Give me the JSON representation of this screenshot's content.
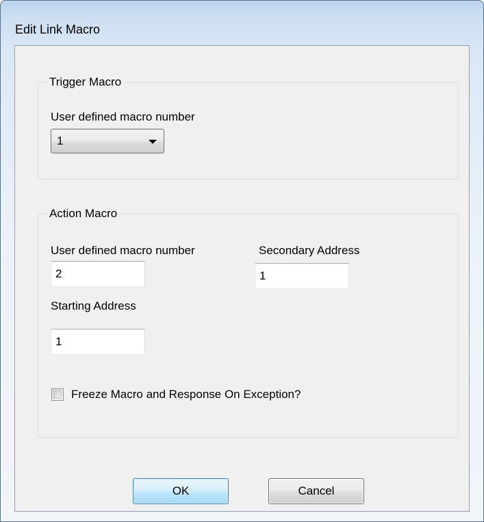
{
  "window": {
    "title": "Edit Link Macro"
  },
  "trigger_group": {
    "legend": "Trigger Macro",
    "macro_number_label": "User defined macro number",
    "macro_number_selected": "1"
  },
  "action_group": {
    "legend": "Action Macro",
    "macro_number_label": "User defined macro number",
    "macro_number_value": "2",
    "secondary_address_label": "Secondary Address",
    "secondary_address_value": "1",
    "starting_address_label": "Starting Address",
    "starting_address_value": "1",
    "freeze_label": "Freeze Macro and Response On Exception?",
    "freeze_checked": false
  },
  "buttons": {
    "ok_label": "OK",
    "cancel_label": "Cancel"
  },
  "icons": {
    "dropdown": "chevron-down-icon"
  },
  "colors": {
    "ok_border": "#3c7fb1",
    "window_border": "#5b6d85",
    "client_bg": "#f0f0f0"
  }
}
